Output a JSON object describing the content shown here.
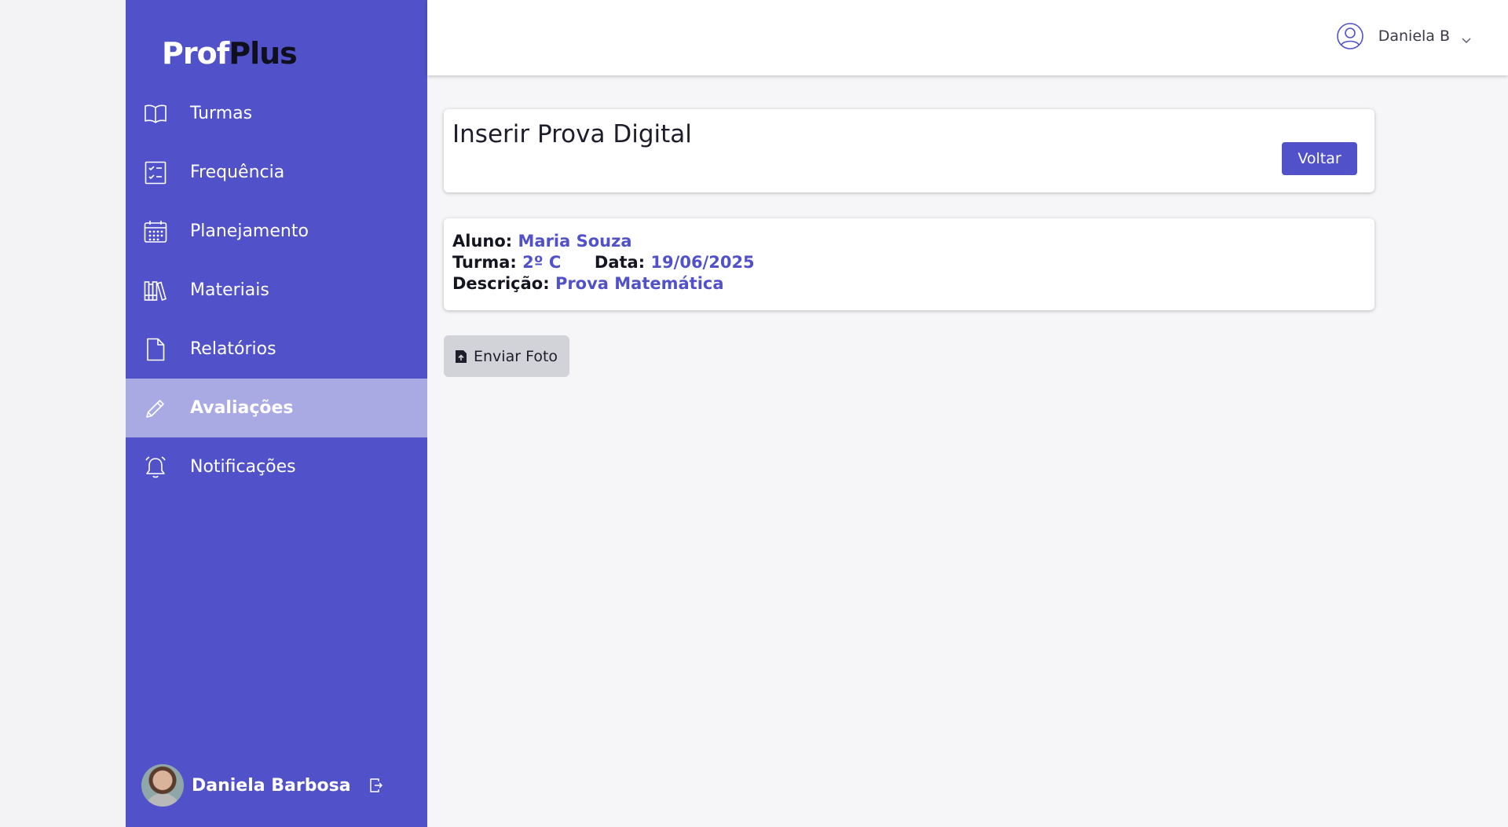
{
  "app": {
    "logo_part1": "Prof",
    "logo_part2": "Plus",
    "colors": {
      "primary": "#5151c9",
      "active_item": "#a9a9e4",
      "logo_dark": "#0f0f1e"
    }
  },
  "sidebar": {
    "items": [
      {
        "label": "Turmas",
        "icon": "book-open-icon",
        "active": false
      },
      {
        "label": "Frequência",
        "icon": "checklist-icon",
        "active": false
      },
      {
        "label": "Planejamento",
        "icon": "calendar-icon",
        "active": false
      },
      {
        "label": "Materiais",
        "icon": "library-icon",
        "active": false
      },
      {
        "label": "Relatórios",
        "icon": "document-icon",
        "active": false
      },
      {
        "label": "Avaliações",
        "icon": "pencil-icon",
        "active": true
      },
      {
        "label": "Notificações",
        "icon": "bell-icon",
        "active": false
      }
    ],
    "footer": {
      "name": "Daniela Barbosa",
      "logout_icon": "logout-icon"
    }
  },
  "topbar": {
    "user_name": "Daniela B",
    "user_icon": "user-circle-icon"
  },
  "header_card": {
    "title": "Inserir Prova Digital",
    "back_button": "Voltar"
  },
  "info_card": {
    "aluno_label": "Aluno:",
    "aluno": "Maria Souza",
    "turma_label": "Turma:",
    "turma": "2º C",
    "data_label": "Data:",
    "data": "19/06/2025",
    "descricao_label": "Descrição:",
    "descricao": "Prova Matemática"
  },
  "upload": {
    "label": "Enviar Foto",
    "icon": "upload-icon"
  }
}
